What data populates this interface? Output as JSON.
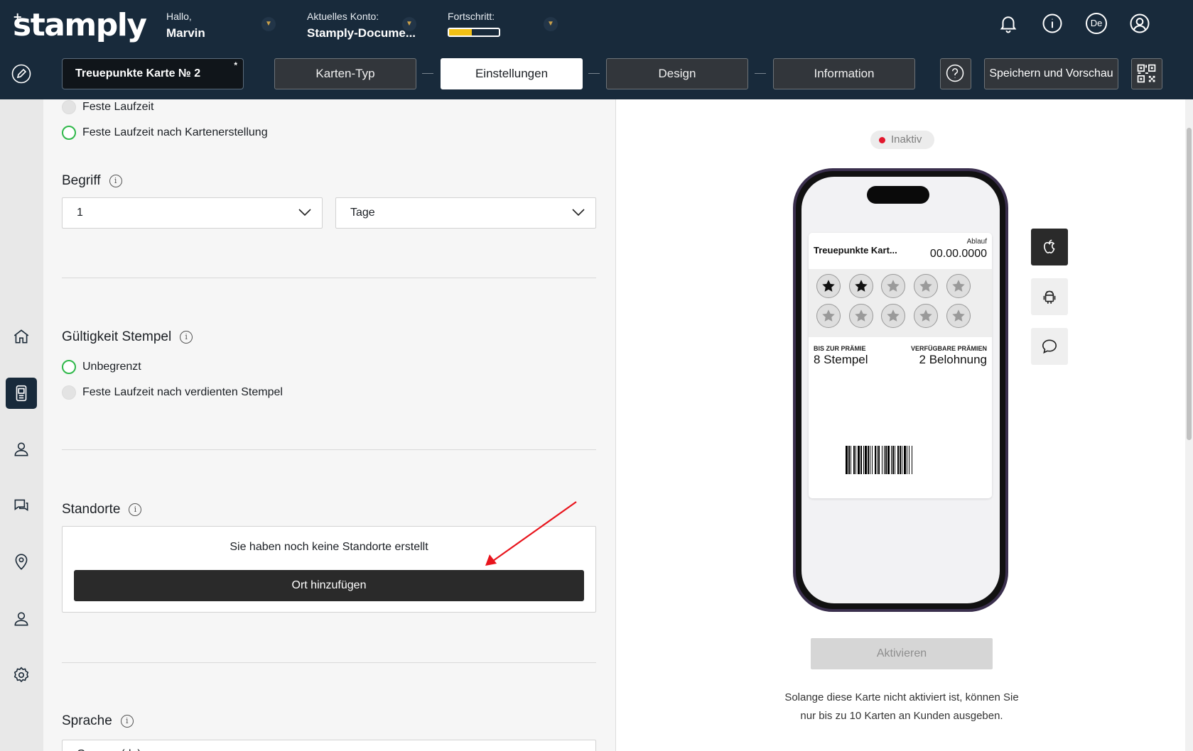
{
  "app": {
    "logo": "stamply",
    "logo_plus": "+"
  },
  "header": {
    "greeting_label": "Hallo,",
    "user_name": "Marvin",
    "account_label": "Aktuelles Konto:",
    "account_name": "Stamply-Docume...",
    "progress_label": "Fortschritt:",
    "progress_value": 0.45,
    "progress_color": "#f2c014",
    "language": "De",
    "icons": [
      "bell-icon",
      "info-icon",
      "language-icon",
      "user-icon"
    ]
  },
  "toolbar": {
    "card_name": "Treuepunkte Karte № 2",
    "unsaved_marker": "*",
    "steps": [
      {
        "label": "Karten-Typ",
        "active": false
      },
      {
        "label": "Einstellungen",
        "active": true
      },
      {
        "label": "Design",
        "active": false
      },
      {
        "label": "Information",
        "active": false
      }
    ],
    "save_label": "Speichern und Vorschau"
  },
  "sidebar": {
    "items": [
      {
        "name": "home",
        "active": false
      },
      {
        "name": "cards",
        "active": true
      },
      {
        "name": "customers",
        "active": false
      },
      {
        "name": "messages",
        "active": false
      },
      {
        "name": "locations",
        "active": false
      },
      {
        "name": "profile",
        "active": false
      },
      {
        "name": "settings",
        "active": false
      }
    ]
  },
  "form": {
    "card_validity": {
      "options": [
        {
          "label": "Feste Laufzeit",
          "selected": false
        },
        {
          "label": "Feste Laufzeit nach Kartenerstellung",
          "selected": true
        }
      ]
    },
    "term": {
      "title": "Begriff",
      "amount": "1",
      "unit": "Tage"
    },
    "stamp_validity": {
      "title": "Gültigkeit Stempel",
      "options": [
        {
          "label": "Unbegrenzt",
          "selected": true
        },
        {
          "label": "Feste Laufzeit nach verdienten Stempel",
          "selected": false
        }
      ]
    },
    "locations": {
      "title": "Standorte",
      "empty_text": "Sie haben noch keine Standorte erstellt",
      "add_button": "Ort hinzufügen"
    },
    "language": {
      "title": "Sprache",
      "value": "German (de)"
    }
  },
  "preview": {
    "status": "Inaktiv",
    "status_color": "#e2172d",
    "pass": {
      "title": "Treuepunkte Kart...",
      "expiry_label": "Ablauf",
      "expiry_value": "00.00.0000",
      "stamps_total": 10,
      "stamps_filled": 2,
      "left_label": "BIS ZUR PRÄMIE",
      "left_value": "8 Stempel",
      "right_label": "VERFÜGBARE PRÄMIEN",
      "right_value": "2 Belohnung"
    },
    "platforms": [
      {
        "name": "apple",
        "active": true
      },
      {
        "name": "android",
        "active": false
      },
      {
        "name": "message",
        "active": false
      }
    ],
    "activate_button": "Aktivieren",
    "note": "Solange diese Karte nicht aktiviert ist, können Sie nur bis zu 10 Karten an Kunden ausgeben."
  }
}
